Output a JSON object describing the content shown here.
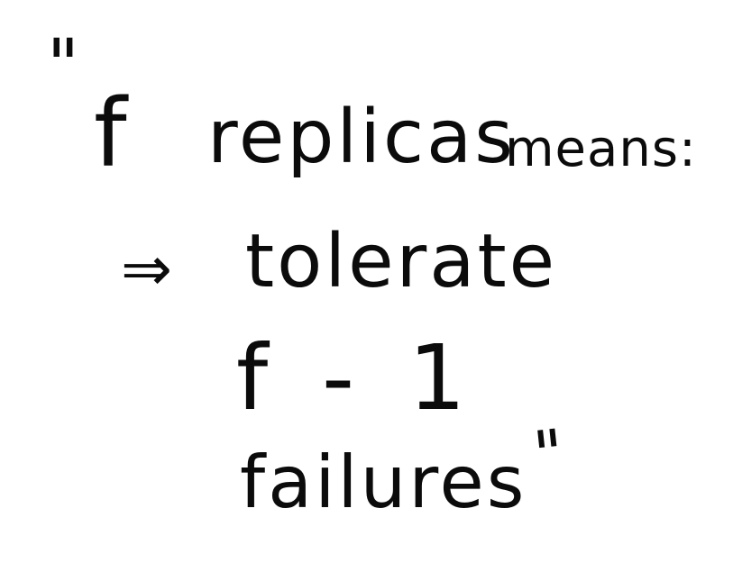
{
  "note": {
    "open_quote": "\"",
    "line1_f": "f",
    "line1_replicas": "replicas",
    "line1_means": "means:",
    "arrow": "⇒",
    "line2": "tolerate",
    "line3": "f - 1",
    "line4": "failures",
    "close_quote": "\""
  },
  "colors": {
    "ink": "#0b0b0b",
    "paper": "#ffffff"
  }
}
